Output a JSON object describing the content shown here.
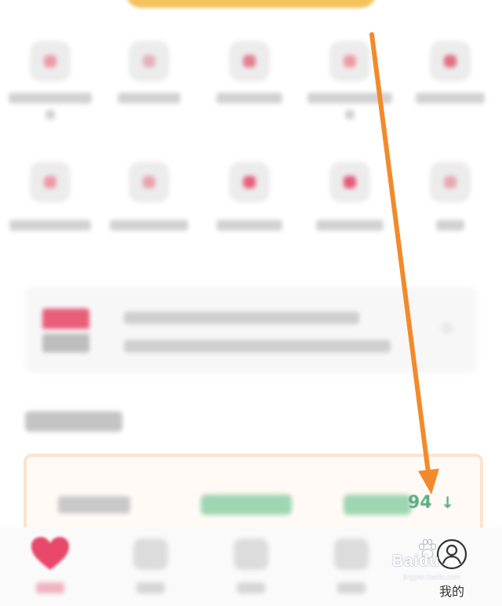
{
  "card": {
    "value_text": "94",
    "trend_symbol": "↓"
  },
  "tabbar": {
    "tabs": [
      {
        "icon": "heart-icon",
        "active": true
      },
      {
        "icon": "tab-icon"
      },
      {
        "icon": "tab-icon"
      },
      {
        "icon": "tab-icon"
      },
      {
        "icon": "user-icon",
        "label": "我的"
      }
    ]
  },
  "watermark": {
    "text": "Baidu",
    "sub": "jingyan.baidu.com"
  },
  "colors": {
    "accent": "#e8486a",
    "annotation_arrow": "#f28a2b",
    "trend_green": "#5aab80",
    "banner": "#f3c25a"
  }
}
